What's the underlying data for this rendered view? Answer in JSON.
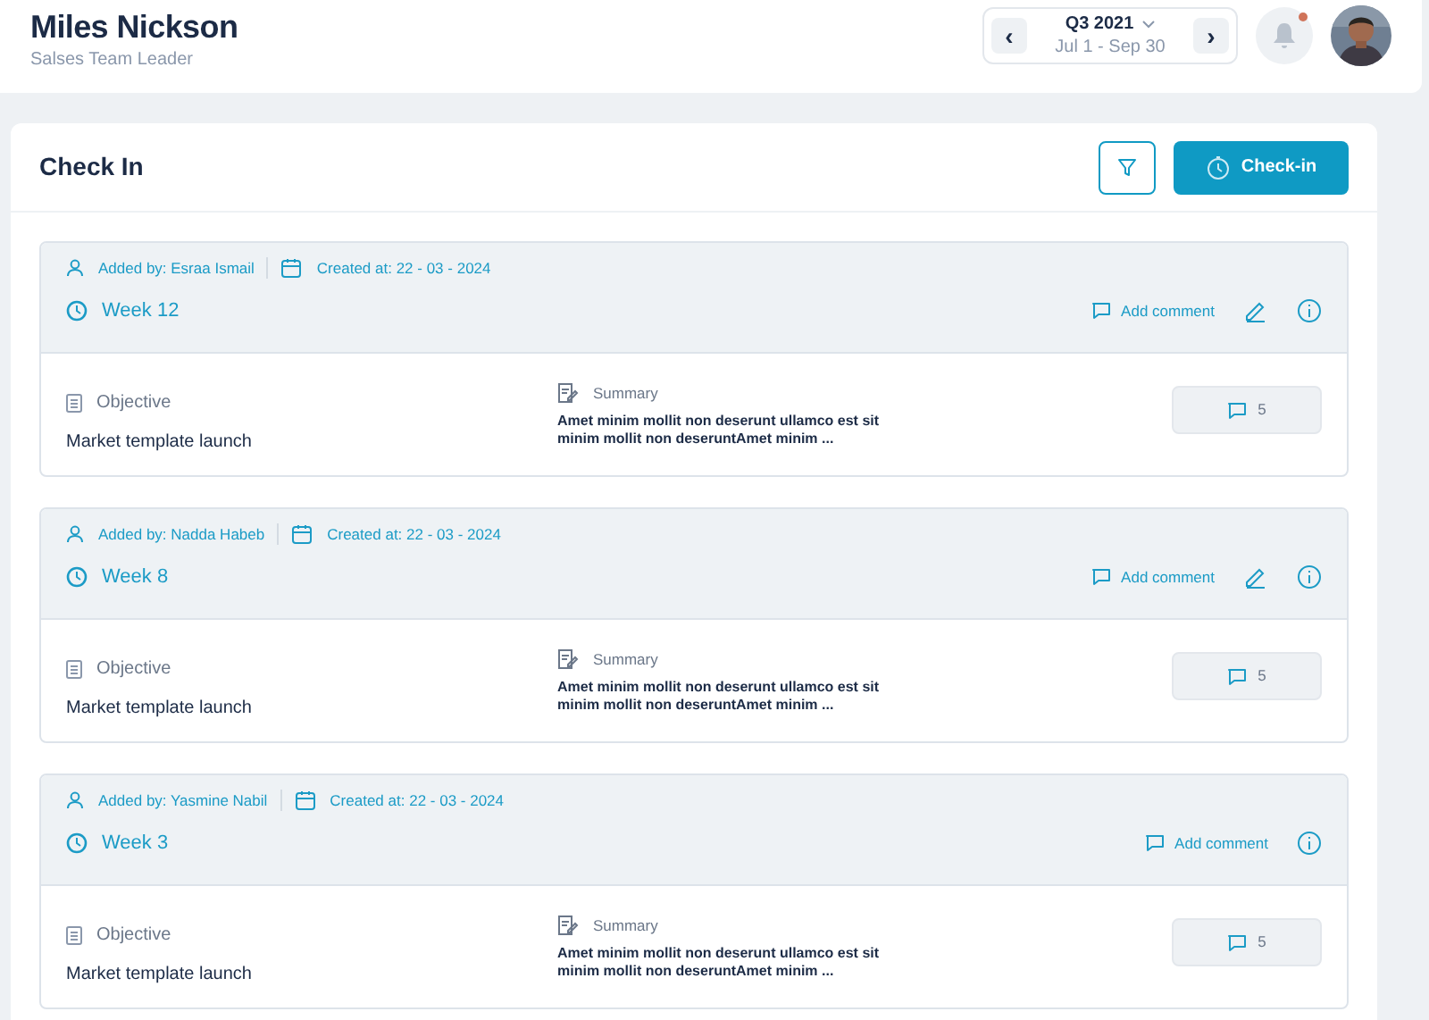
{
  "header": {
    "name": "Miles Nickson",
    "role": "Salses Team Leader",
    "period": {
      "title": "Q3 2021",
      "range": "Jul 1 - Sep 30",
      "prev": "‹",
      "next": "›"
    },
    "has_notification": true
  },
  "panel": {
    "title": "Check In",
    "checkin_label": "Check-in"
  },
  "entries": [
    {
      "added_by": "Added by: Esraa Ismail",
      "created_at": "Created at: 22 - 03 - 2024",
      "week": "Week 12",
      "add_comment": "Add comment",
      "editable": true,
      "objective_label": "Objective",
      "objective": "Market template launch",
      "summary_label": "Summary",
      "summary": "Amet minim mollit non deserunt ullamco est sit minim mollit non deseruntAmet minim ...",
      "comments": "5"
    },
    {
      "added_by": "Added by: Nadda Habeb",
      "created_at": "Created at: 22 - 03 - 2024",
      "week": "Week 8",
      "add_comment": "Add comment",
      "editable": true,
      "objective_label": "Objective",
      "objective": "Market template launch",
      "summary_label": "Summary",
      "summary": "Amet minim mollit non deserunt ullamco est sit minim mollit non deseruntAmet minim ...",
      "comments": "5"
    },
    {
      "added_by": "Added by: Yasmine Nabil",
      "created_at": "Created at: 22 - 03 - 2024",
      "week": "Week 3",
      "add_comment": "Add comment",
      "editable": false,
      "objective_label": "Objective",
      "objective": "Market template launch",
      "summary_label": "Summary",
      "summary": "Amet minim mollit non deserunt ullamco est sit minim mollit non deseruntAmet minim ...",
      "comments": "5"
    }
  ]
}
